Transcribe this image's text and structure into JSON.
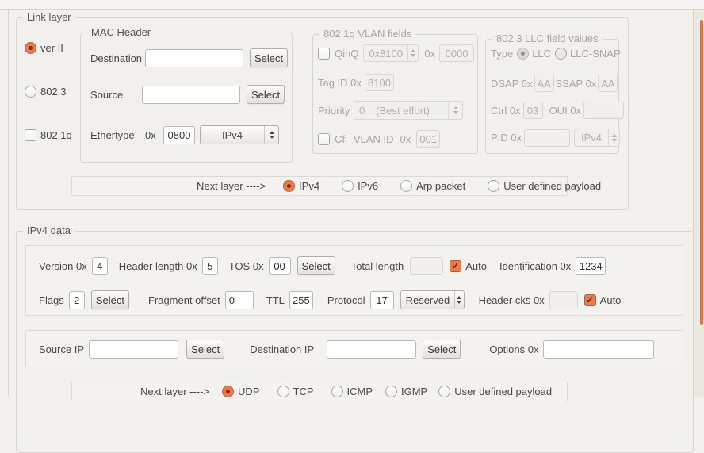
{
  "window": {
    "accent_color": "#e77c50",
    "scrollbar_color": "#e2713f",
    "background_color": "#f2f0ed"
  },
  "link_layer": {
    "title": "Link layer",
    "frame_type_options": [
      {
        "label": "ver II",
        "type": "radio",
        "checked": true
      },
      {
        "label": "802.3",
        "type": "radio",
        "checked": false
      },
      {
        "label": "802.1q",
        "type": "checkbox",
        "checked": false
      }
    ],
    "mac_header": {
      "title": "MAC Header",
      "destination_label": "Destination",
      "destination_value": "",
      "source_label": "Source",
      "source_value": "",
      "select_label": "Select",
      "ethertype_label": "Ethertype",
      "hex_prefix": "0x",
      "ethertype_value": "0800",
      "ethertype_protocol": "IPv4"
    },
    "vlan_fields": {
      "title": "802.1q VLAN fields",
      "enabled": false,
      "qinq_label": "QinQ",
      "qinq_checked": false,
      "qinq_tpid": "0x8100",
      "hex_prefix": "0x",
      "qinq_value": "0000",
      "tag_id_label": "Tag ID 0x",
      "tag_id_value": "8100",
      "priority_label": "Priority",
      "priority_value": "0",
      "priority_hint": "(Best effort)",
      "cfi_label": "Cfi",
      "cfi_checked": false,
      "vlan_id_label": "VLAN ID",
      "vlan_id_value": "001"
    },
    "llc_fields": {
      "title": "802.3 LLC field values",
      "enabled": false,
      "type_label": "Type",
      "type_options": [
        {
          "label": "LLC",
          "checked": true
        },
        {
          "label": "LLC-SNAP",
          "checked": false
        }
      ],
      "dsap_label": "DSAP 0x",
      "dsap_value": "AA",
      "ssap_label": "SSAP 0x",
      "ssap_value": "AA",
      "ctrl_label": "Ctrl 0x",
      "ctrl_value": "03",
      "oui_label": "OUI 0x",
      "oui_value": "",
      "pid_label": "PID 0x",
      "pid_value": "",
      "pid_protocol": "IPv4"
    },
    "next_layer": {
      "label": "Next layer ---->",
      "options": [
        {
          "label": "IPv4",
          "checked": true
        },
        {
          "label": "IPv6",
          "checked": false
        },
        {
          "label": "Arp packet",
          "checked": false
        },
        {
          "label": "User defined payload",
          "checked": false
        }
      ]
    }
  },
  "ipv4_data": {
    "title": "IPv4 data",
    "select_label": "Select",
    "auto_label": "Auto",
    "version_label": "Version 0x",
    "version_value": "4",
    "header_length_label": "Header length 0x",
    "header_length_value": "5",
    "tos_label": "TOS 0x",
    "tos_value": "00",
    "total_length_label": "Total length",
    "total_length_value": "",
    "total_length_auto_checked": true,
    "identification_label": "Identification 0x",
    "identification_value": "1234",
    "flags_label": "Flags",
    "flags_value": "2",
    "fragment_offset_label": "Fragment offset",
    "fragment_offset_value": "0",
    "ttl_label": "TTL",
    "ttl_value": "255",
    "protocol_label": "Protocol",
    "protocol_value": "17",
    "protocol_name": "Reserved",
    "header_cks_label": "Header cks 0x",
    "header_cks_value": "",
    "header_cks_auto_checked": true,
    "source_ip_label": "Source IP",
    "source_ip_value": "",
    "destination_ip_label": "Destination IP",
    "destination_ip_value": "",
    "options_label": "Options 0x",
    "options_value": "",
    "next_layer": {
      "label": "Next layer ---->",
      "options": [
        {
          "label": "UDP",
          "checked": true
        },
        {
          "label": "TCP",
          "checked": false
        },
        {
          "label": "ICMP",
          "checked": false
        },
        {
          "label": "IGMP",
          "checked": false
        },
        {
          "label": "User defined payload",
          "checked": false
        }
      ]
    }
  }
}
